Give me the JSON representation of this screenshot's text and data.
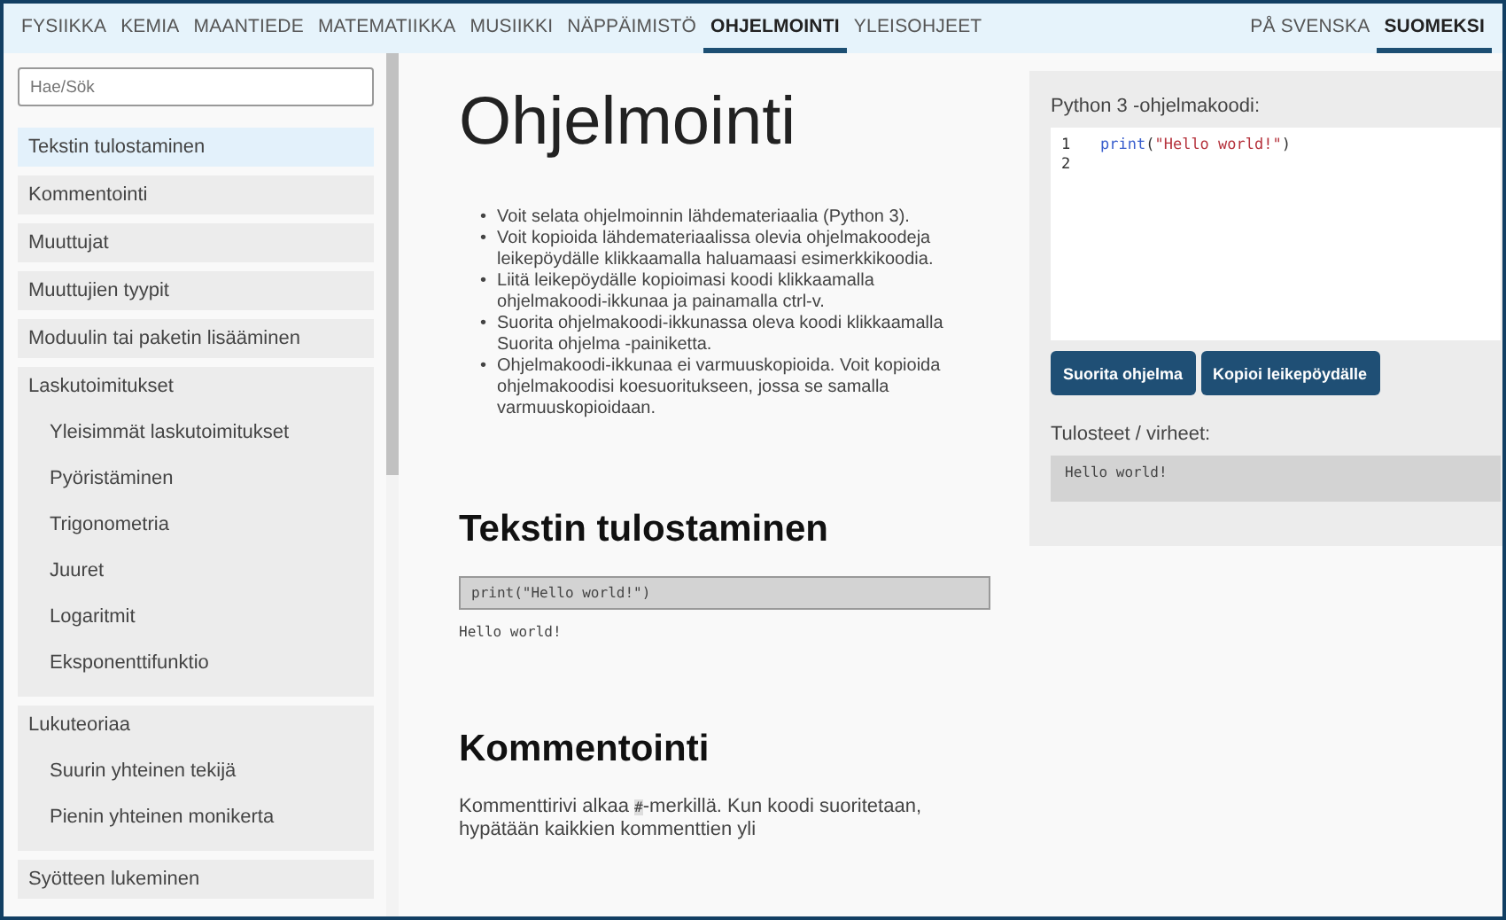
{
  "nav": {
    "subjects": [
      {
        "label": "FYSIIKKA",
        "selected": false
      },
      {
        "label": "KEMIA",
        "selected": false
      },
      {
        "label": "MAANTIEDE",
        "selected": false
      },
      {
        "label": "MATEMATIIKKA",
        "selected": false
      },
      {
        "label": "MUSIIKKI",
        "selected": false
      },
      {
        "label": "NÄPPÄIMISTÖ",
        "selected": false
      },
      {
        "label": "OHJELMOINTI",
        "selected": true
      },
      {
        "label": "YLEISOHJEET",
        "selected": false
      }
    ],
    "languages": [
      {
        "label": "PÅ SVENSKA",
        "selected": false
      },
      {
        "label": "SUOMEKSI",
        "selected": true
      }
    ]
  },
  "sidebar": {
    "search": {
      "placeholder": "Hae/Sök"
    },
    "items": [
      {
        "label": "Tekstin tulostaminen",
        "selected": true
      },
      {
        "label": "Kommentointi",
        "selected": false
      },
      {
        "label": "Muuttujat",
        "selected": false
      },
      {
        "label": "Muuttujien tyypit",
        "selected": false
      },
      {
        "label": "Moduulin tai paketin lisääminen",
        "selected": false
      },
      {
        "label": "Laskutoimitukset",
        "children": [
          {
            "label": "Yleisimmät laskutoimitukset",
            "selected": false
          },
          {
            "label": "Pyöristäminen",
            "selected": false
          },
          {
            "label": "Trigonometria",
            "selected": false
          },
          {
            "label": "Juuret",
            "selected": false
          },
          {
            "label": "Logaritmit",
            "selected": false
          },
          {
            "label": "Eksponenttifunktio",
            "selected": false
          }
        ]
      },
      {
        "label": "Lukuteoriaa",
        "children": [
          {
            "label": "Suurin yhteinen tekijä",
            "selected": false
          },
          {
            "label": "Pienin yhteinen monikerta",
            "selected": false
          }
        ]
      },
      {
        "label": "Syötteen lukeminen",
        "selected": false
      }
    ]
  },
  "main": {
    "title": "Ohjelmointi",
    "bullets": [
      {
        "marker": "•",
        "text": "Voit selata ohjelmoinnin lähdemateriaalia (Python 3)."
      },
      {
        "marker": "•",
        "text": "Voit kopioida lähdemateriaalissa olevia ohjelmakoodeja leikepöydälle klikkaamalla haluamaasi esimerkkikoodia."
      },
      {
        "marker": "•",
        "text": "Liitä leikepöydälle kopioimasi koodi klikkaamalla ohjelmakoodi-ikkunaa ja painamalla ctrl-v."
      },
      {
        "marker": "•",
        "text": "Suorita ohjelmakoodi-ikkunassa oleva koodi klikkaamalla Suorita ohjelma -painiketta."
      },
      {
        "marker": "•",
        "text": "Ohjelmakoodi-ikkunaa ei varmuuskopioida. Voit kopioida ohjelmakoodisi koesuoritukseen, jossa se samalla varmuuskopioidaan."
      }
    ],
    "sections": [
      {
        "heading": "Tekstin tulostaminen",
        "code": "print(\"Hello world!\")",
        "output": "Hello world!"
      },
      {
        "heading": "Kommentointi",
        "text": {
          "before": "Kommenttirivi alkaa ",
          "code": "#",
          "after": "-merkillä. Kun koodi suoritetaan, hypätään kaikkien kommenttien yli"
        }
      }
    ]
  },
  "editor": {
    "label": "Python 3 -ohjelmakoodi:",
    "lines": [
      {
        "number": "1",
        "tokens": [
          {
            "text": "print",
            "kind": "builtin"
          },
          {
            "text": "(",
            "kind": "punct"
          },
          {
            "text": "\"Hello world!\"",
            "kind": "string"
          },
          {
            "text": ")",
            "kind": "punct"
          }
        ]
      },
      {
        "number": "2"
      }
    ],
    "buttons": [
      "Suorita ohjelma",
      "Kopioi leikepöydälle"
    ],
    "output_label": "Tulosteet / virheet:",
    "output": "Hello world!"
  }
}
